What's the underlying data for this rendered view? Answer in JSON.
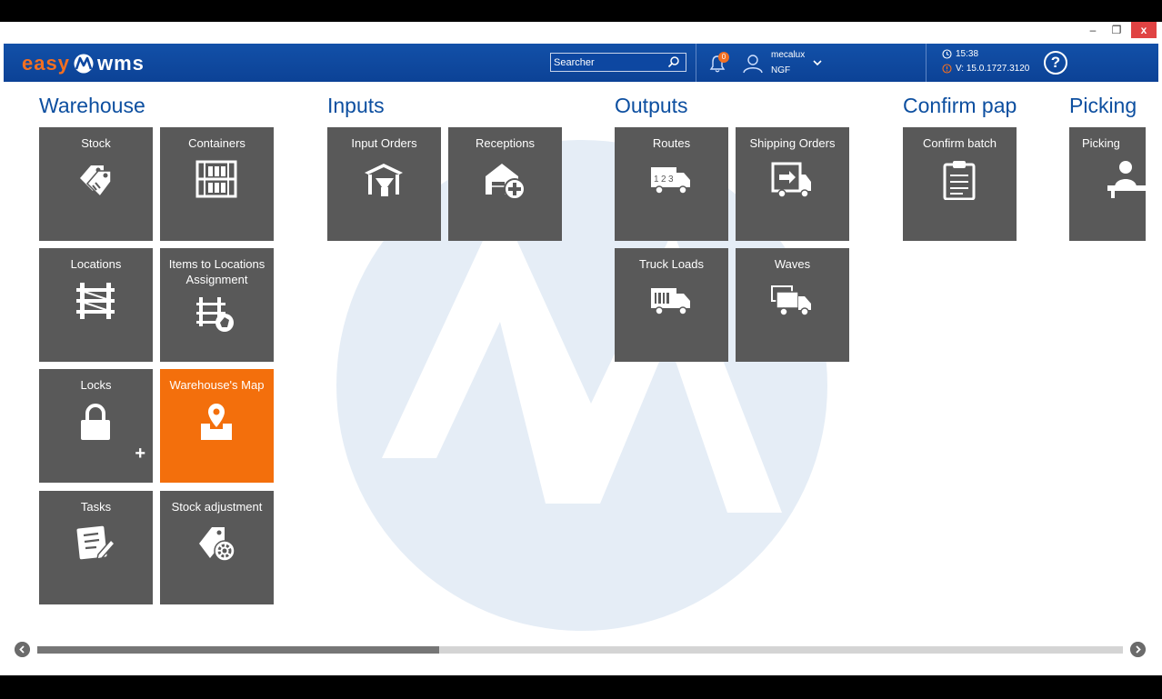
{
  "window": {
    "minimize": "–",
    "maximize": "❐",
    "close": "x"
  },
  "header": {
    "logo_left": "easy",
    "logo_right": "wms",
    "search_placeholder": "Searcher",
    "notifications": "0",
    "user_name": "mecalux",
    "user_site": "NGF",
    "time": "15:38",
    "version": "V: 15.0.1727.3120",
    "help": "?"
  },
  "groups": [
    {
      "title": "Warehouse"
    },
    {
      "title": "Inputs"
    },
    {
      "title": "Outputs"
    },
    {
      "title": "Confirm pap"
    },
    {
      "title": "Picking"
    }
  ],
  "tiles": {
    "stock": "Stock",
    "containers": "Containers",
    "locations": "Locations",
    "items_to_locations": "Items to Locations Assignment",
    "locks": "Locks",
    "warehouse_map": "Warehouse's Map",
    "tasks": "Tasks",
    "stock_adjustment": "Stock adjustment",
    "input_orders": "Input Orders",
    "receptions": "Receptions",
    "routes": "Routes",
    "shipping_orders": "Shipping Orders",
    "truck_loads": "Truck Loads",
    "waves": "Waves",
    "confirm_batch": "Confirm batch",
    "picking": "Picking"
  },
  "scrollbar": {
    "position_fraction": 0.37
  },
  "colors": {
    "topbar": "#0d47a1",
    "accent": "#f36f21",
    "tile": "#595959",
    "tile_active": "#f36f0c",
    "group_title": "#0d4fa0"
  }
}
